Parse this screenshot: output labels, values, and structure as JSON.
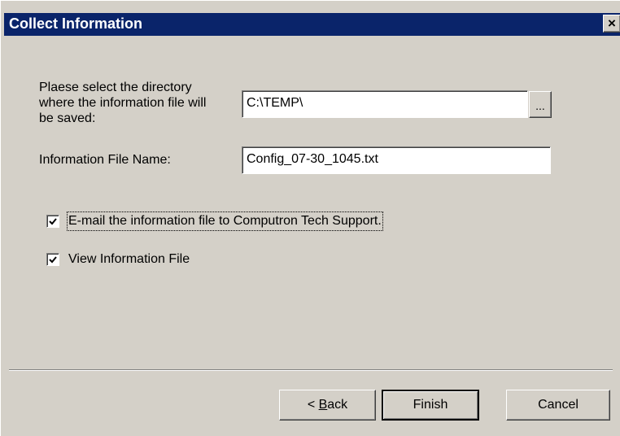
{
  "window": {
    "title": "Collect Information",
    "close_label": "×"
  },
  "form": {
    "directory_label_line1": "Plaese select the directory",
    "directory_label_line2": "where the information file will",
    "directory_label_line3": "be saved:",
    "directory_value": "C:\\TEMP\\",
    "browse_label": "...",
    "filename_label": "Information File Name:",
    "filename_value": "Config_07-30_1045.txt"
  },
  "options": {
    "email": {
      "label": "E-mail the information file to Computron Tech Support.",
      "checked": true
    },
    "view": {
      "label": "View Information File",
      "checked": true
    }
  },
  "buttons": {
    "back_prefix": "< ",
    "back_mnemonic": "B",
    "back_rest": "ack",
    "finish": "Finish",
    "cancel": "Cancel"
  }
}
